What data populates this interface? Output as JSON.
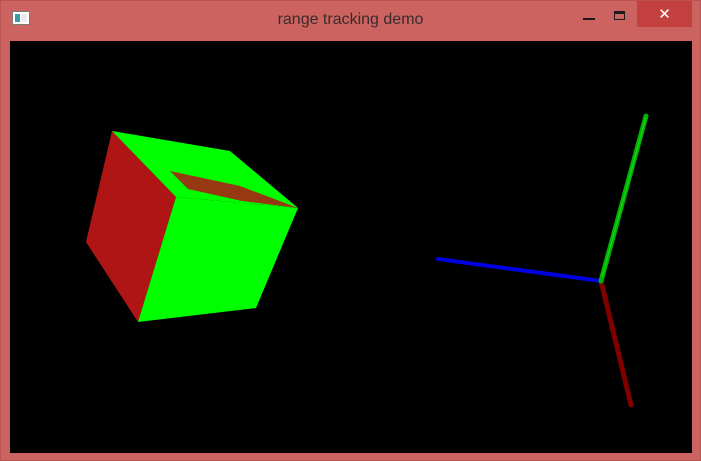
{
  "window": {
    "title": "range tracking demo",
    "accent_color": "#cc6360",
    "controls": {
      "minimize_icon": "minimize-icon",
      "maximize_icon": "maximize-icon",
      "close_glyph": "✕"
    }
  },
  "scene": {
    "background": "#000000",
    "cube_colors": {
      "light": "#00ff00",
      "dark": "#b01515"
    },
    "axis_colors": {
      "x": "#0000e0",
      "y": "#00b000",
      "z": "#800000"
    }
  }
}
